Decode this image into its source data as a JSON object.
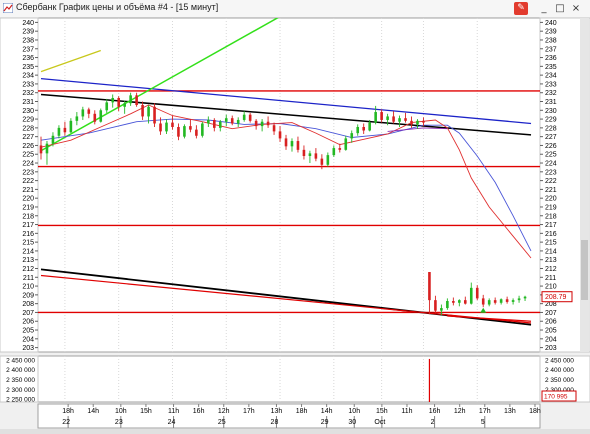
{
  "window": {
    "title": "Сбербанк График цены и объёма #4 - [15 минут]",
    "buttons": {
      "pin": "✎",
      "minimize": "_",
      "maximize": "□",
      "close": "×"
    }
  },
  "colors": {
    "bg": "#ffffff",
    "up_candle": "#23b823",
    "down_candle": "#d82020",
    "level_red": "#e00000",
    "trend_black": "#000000",
    "trend_blue": "#1c23c8",
    "trend_green": "#33e01a",
    "trend_yellow": "#c8c81c",
    "ma_red": "#e03030",
    "ma_blue": "#4a56d8",
    "ma_purple": "#8a2ab0",
    "price_label": "#d00000"
  },
  "chart_data": {
    "type": "candlestick",
    "price_axis": {
      "ylim": [
        202.5,
        240.5
      ],
      "ticks": [
        "240",
        "239",
        "238",
        "237",
        "236",
        "235",
        "234",
        "233",
        "232",
        "231",
        "230",
        "229",
        "228",
        "227",
        "226",
        "225",
        "224",
        "223",
        "222",
        "221",
        "220",
        "219",
        "218",
        "217",
        "216",
        "215",
        "214",
        "213",
        "212",
        "211",
        "210",
        "209",
        "208",
        "207",
        "206",
        "205",
        "204",
        "203"
      ],
      "last_price_label": "208.79"
    },
    "volume_axis": {
      "ylim": [
        2235000,
        2470000
      ],
      "ticks": [
        "2 450 000",
        "2 400 000",
        "2 350 000",
        "2 300 000",
        "2 250 000"
      ],
      "last_volume_label": "170 995"
    },
    "x_axis": {
      "time_labels": [
        "18h",
        "14h",
        "10h",
        "15h",
        "11h",
        "16h",
        "12h",
        "17h",
        "13h",
        "18h",
        "14h",
        "10h",
        "15h",
        "11h",
        "16h",
        "12h",
        "17h",
        "13h",
        "18h"
      ],
      "date_labels": [
        "22",
        "23",
        "24",
        "25",
        "28",
        "29",
        "30",
        "Oct",
        "2",
        "5"
      ]
    },
    "horizontal_levels": [
      232.2,
      223.6,
      216.9,
      207.0
    ],
    "trend_lines": [
      {
        "name": "black-upper",
        "points": [
          [
            0,
            231.8
          ],
          [
            82,
            227.2
          ]
        ]
      },
      {
        "name": "blue-upper",
        "points": [
          [
            0,
            233.6
          ],
          [
            82,
            228.5
          ]
        ]
      },
      {
        "name": "green",
        "points": [
          [
            0,
            225.4
          ],
          [
            44,
            242.2
          ]
        ]
      },
      {
        "name": "yellow",
        "points": [
          [
            0,
            234.4
          ],
          [
            10,
            236.8
          ]
        ]
      },
      {
        "name": "black-lower",
        "points": [
          [
            0,
            211.9
          ],
          [
            82,
            205.6
          ]
        ]
      },
      {
        "name": "red-lower",
        "points": [
          [
            0,
            211.2
          ],
          [
            82,
            205.8
          ]
        ]
      },
      {
        "name": "red-short",
        "points": [
          [
            68,
            206.6
          ],
          [
            82,
            206.0
          ]
        ]
      }
    ],
    "ma_red": [
      [
        0,
        225.8
      ],
      [
        5,
        226.6
      ],
      [
        10,
        228.1
      ],
      [
        15,
        229.6
      ],
      [
        18,
        230.6
      ],
      [
        22,
        229.4
      ],
      [
        27,
        228.7
      ],
      [
        32,
        227.9
      ],
      [
        37,
        228.4
      ],
      [
        42,
        228.6
      ],
      [
        46,
        227.4
      ],
      [
        50,
        226.1
      ],
      [
        54,
        226.7
      ],
      [
        58,
        227.3
      ],
      [
        62,
        228.6
      ],
      [
        66,
        228.9
      ],
      [
        68,
        228.0
      ],
      [
        70,
        225.5
      ],
      [
        72,
        222.3
      ],
      [
        75,
        219.0
      ],
      [
        78,
        216.5
      ],
      [
        82,
        213.2
      ]
    ],
    "ma_blue": [
      [
        0,
        226.6
      ],
      [
        8,
        227.4
      ],
      [
        16,
        228.7
      ],
      [
        22,
        229.0
      ],
      [
        28,
        228.9
      ],
      [
        34,
        228.4
      ],
      [
        40,
        228.5
      ],
      [
        46,
        227.9
      ],
      [
        52,
        226.9
      ],
      [
        58,
        227.3
      ],
      [
        64,
        228.3
      ],
      [
        68,
        228.3
      ],
      [
        70,
        227.4
      ],
      [
        73,
        224.8
      ],
      [
        76,
        221.8
      ],
      [
        79,
        218.0
      ],
      [
        82,
        214.0
      ]
    ],
    "ma_purple": [
      [
        58,
        227.6
      ],
      [
        64,
        228.0
      ],
      [
        68,
        227.9
      ]
    ],
    "candles": [
      [
        226,
        227,
        224.4,
        225.1
      ],
      [
        225.1,
        226.5,
        223.8,
        226.2
      ],
      [
        226.2,
        227.5,
        225.9,
        227.1
      ],
      [
        227.1,
        228.3,
        226.8,
        228.0
      ],
      [
        228.0,
        228.7,
        227.1,
        227.5
      ],
      [
        227.5,
        229.1,
        227.4,
        228.8
      ],
      [
        228.8,
        229.8,
        228.3,
        229.3
      ],
      [
        229.3,
        230.4,
        228.9,
        230.1
      ],
      [
        230.1,
        230.3,
        229.1,
        229.6
      ],
      [
        229.6,
        230.0,
        228.4,
        228.7
      ],
      [
        228.7,
        230.2,
        228.6,
        230.0
      ],
      [
        230.0,
        231.3,
        229.7,
        230.9
      ],
      [
        230.9,
        231.8,
        230.3,
        231.4
      ],
      [
        231.4,
        231.6,
        229.9,
        230.4
      ],
      [
        230.4,
        231.1,
        229.6,
        230.8
      ],
      [
        230.8,
        232.0,
        230.5,
        231.7
      ],
      [
        231.7,
        232.0,
        230.4,
        230.6
      ],
      [
        230.6,
        231.0,
        228.9,
        229.3
      ],
      [
        229.3,
        230.6,
        228.5,
        230.4
      ],
      [
        230.4,
        230.8,
        228.1,
        228.5
      ],
      [
        228.5,
        229.2,
        227.2,
        227.6
      ],
      [
        227.6,
        229.0,
        227.3,
        228.6
      ],
      [
        228.6,
        229.4,
        227.8,
        228.1
      ],
      [
        228.1,
        228.5,
        226.6,
        227.0
      ],
      [
        227.0,
        228.4,
        226.8,
        228.2
      ],
      [
        228.2,
        229.0,
        227.5,
        227.8
      ],
      [
        227.8,
        228.3,
        226.8,
        227.1
      ],
      [
        227.1,
        228.7,
        226.9,
        228.5
      ],
      [
        228.5,
        229.3,
        228.1,
        228.9
      ],
      [
        228.9,
        229.1,
        227.6,
        228.0
      ],
      [
        228.0,
        228.9,
        227.6,
        228.7
      ],
      [
        228.7,
        229.5,
        228.2,
        229.1
      ],
      [
        229.1,
        229.4,
        228.3,
        228.5
      ],
      [
        228.5,
        229.2,
        228.1,
        228.9
      ],
      [
        228.9,
        229.9,
        228.7,
        229.5
      ],
      [
        229.5,
        229.7,
        228.6,
        228.8
      ],
      [
        228.8,
        229.0,
        227.8,
        228.2
      ],
      [
        228.2,
        229.0,
        227.6,
        228.7
      ],
      [
        228.7,
        229.3,
        228.0,
        228.3
      ],
      [
        228.3,
        228.6,
        227.2,
        227.6
      ],
      [
        227.6,
        228.2,
        226.4,
        226.8
      ],
      [
        226.8,
        227.2,
        225.5,
        225.9
      ],
      [
        225.9,
        226.8,
        225.3,
        226.5
      ],
      [
        226.5,
        227.0,
        225.2,
        225.5
      ],
      [
        225.5,
        226.0,
        224.4,
        224.8
      ],
      [
        224.8,
        225.4,
        224.0,
        225.1
      ],
      [
        225.1,
        225.7,
        224.2,
        224.5
      ],
      [
        224.5,
        225.0,
        223.3,
        223.8
      ],
      [
        223.8,
        225.2,
        223.6,
        224.9
      ],
      [
        224.9,
        226.0,
        224.7,
        225.7
      ],
      [
        225.7,
        226.2,
        225.2,
        225.5
      ],
      [
        225.5,
        227.1,
        225.4,
        226.8
      ],
      [
        226.8,
        227.7,
        226.3,
        227.4
      ],
      [
        227.4,
        228.4,
        227.1,
        228.1
      ],
      [
        228.1,
        228.5,
        227.3,
        227.7
      ],
      [
        227.7,
        228.9,
        227.6,
        228.6
      ],
      [
        228.6,
        230.5,
        228.4,
        229.8
      ],
      [
        229.8,
        230.1,
        228.6,
        228.9
      ],
      [
        228.9,
        229.6,
        228.3,
        229.3
      ],
      [
        229.3,
        229.9,
        228.5,
        228.7
      ],
      [
        228.7,
        229.4,
        228.1,
        229.1
      ],
      [
        229.1,
        229.7,
        228.6,
        228.8
      ],
      [
        228.8,
        229.3,
        228.0,
        228.4
      ],
      [
        228.4,
        229.0,
        227.9,
        228.8
      ],
      [
        228.8,
        229.2,
        228.2,
        228.6
      ],
      [
        211.6,
        211.6,
        206.8,
        208.4
      ],
      [
        208.4,
        208.9,
        206.9,
        207.2
      ],
      [
        207.2,
        207.9,
        206.7,
        207.5
      ],
      [
        207.5,
        208.6,
        207.3,
        208.3
      ],
      [
        208.3,
        208.7,
        207.8,
        208.1
      ],
      [
        208.1,
        208.5,
        207.7,
        208.4
      ],
      [
        208.4,
        208.8,
        207.9,
        208.0
      ],
      [
        208.0,
        210.4,
        207.9,
        209.8
      ],
      [
        209.8,
        210.1,
        208.4,
        208.6
      ],
      [
        208.6,
        209.0,
        207.6,
        207.9
      ],
      [
        207.9,
        208.6,
        207.7,
        208.4
      ],
      [
        208.4,
        208.7,
        207.9,
        208.1
      ],
      [
        208.1,
        208.6,
        207.9,
        208.5
      ],
      [
        208.5,
        208.8,
        208.0,
        208.2
      ],
      [
        208.2,
        208.6,
        207.9,
        208.4
      ],
      [
        208.4,
        208.9,
        208.1,
        208.6
      ],
      [
        208.6,
        208.9,
        208.3,
        208.79
      ]
    ],
    "volume_spike": {
      "index": 65,
      "value": 2455000
    }
  }
}
